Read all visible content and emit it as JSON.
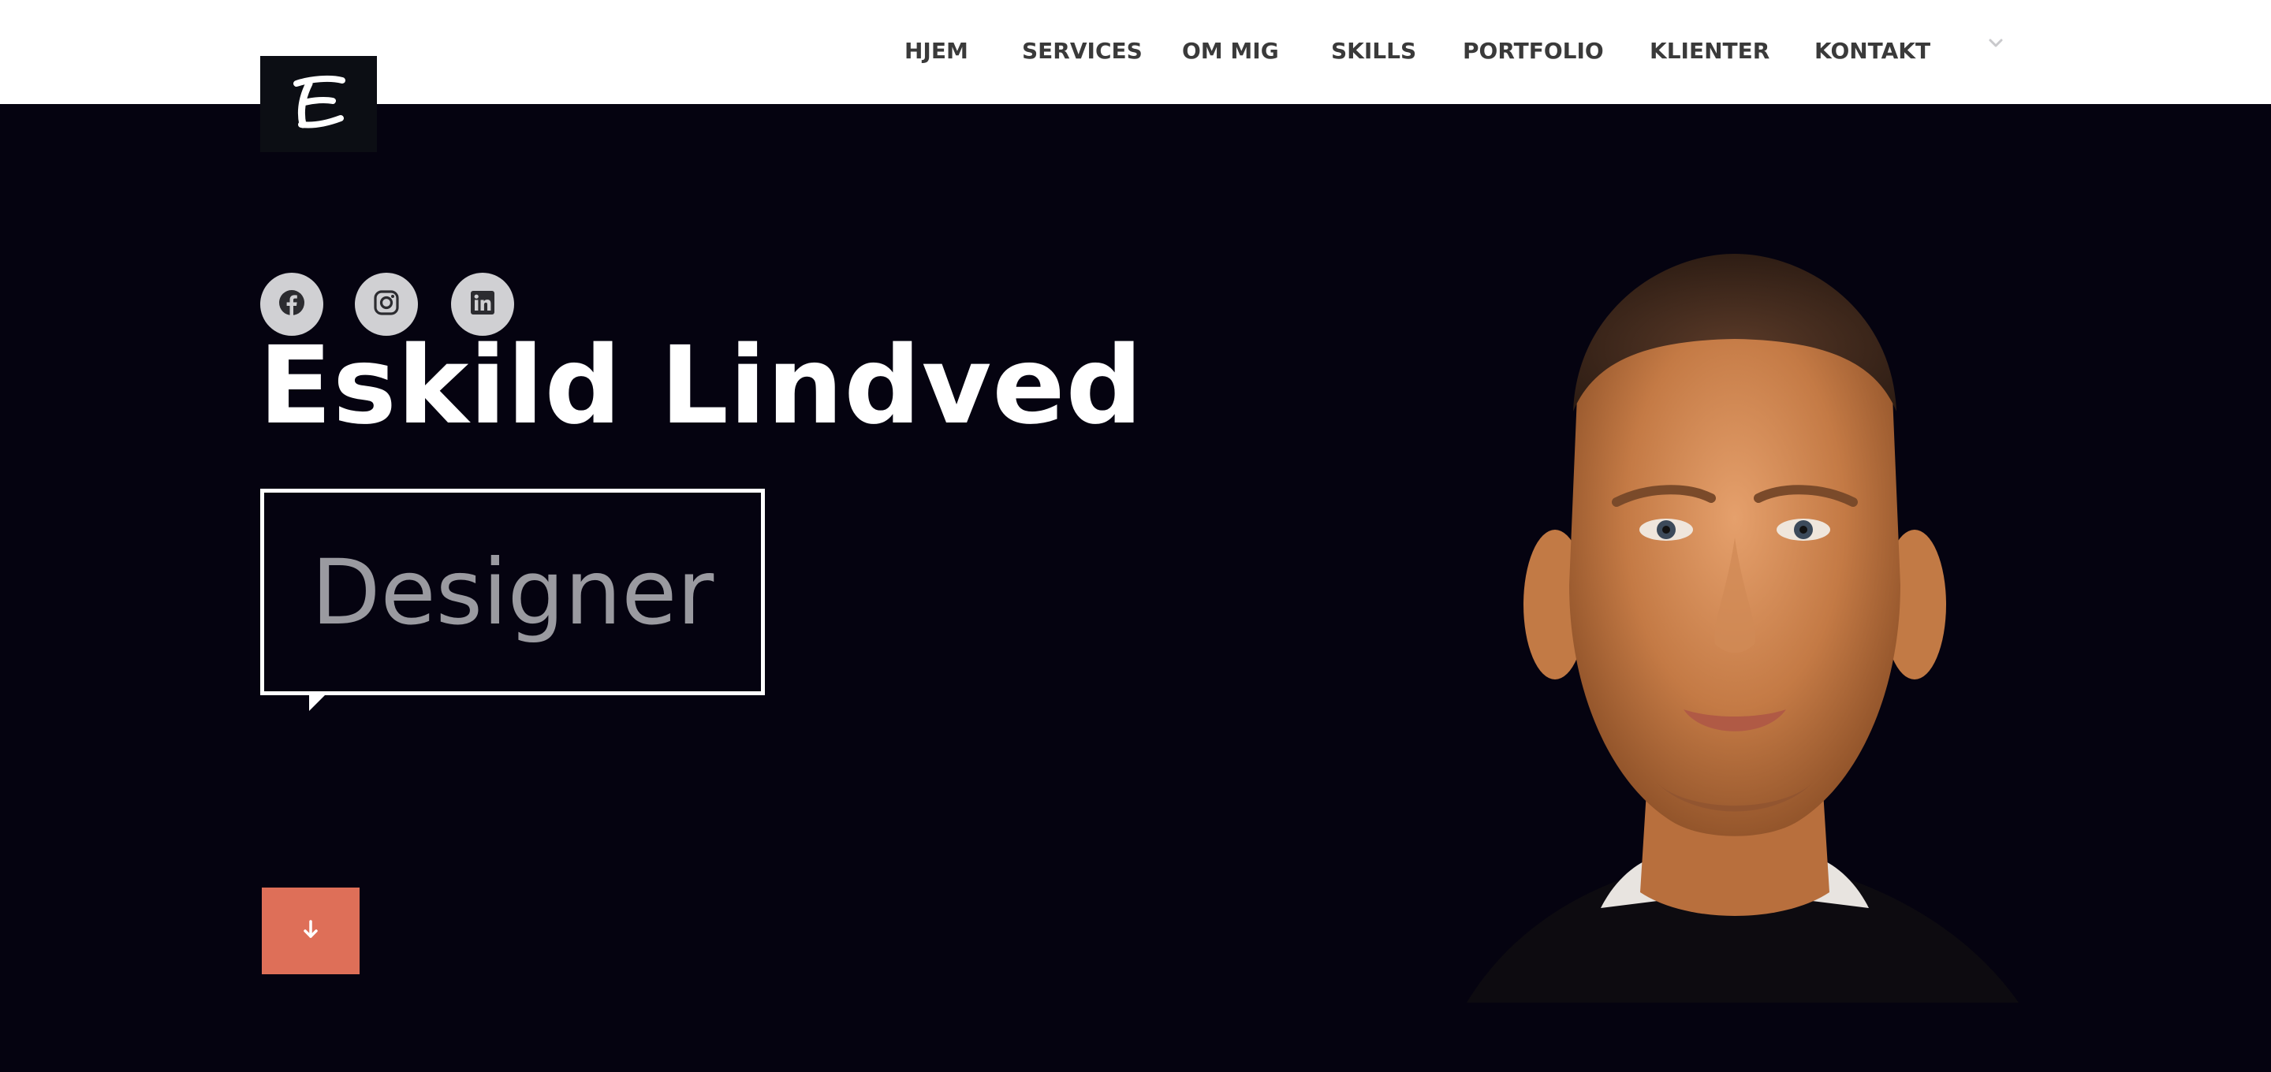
{
  "header": {
    "logo_icon": "e-letter-logo-icon",
    "nav": [
      {
        "label": "HJEM"
      },
      {
        "label": "SERVICES"
      },
      {
        "label": "OM MIG"
      },
      {
        "label": "SKILLS"
      },
      {
        "label": "PORTFOLIO"
      },
      {
        "label": "KLIENTER"
      },
      {
        "label": "KONTAKT"
      }
    ],
    "dropdown_icon": "chevron-down-icon"
  },
  "hero": {
    "social": [
      {
        "icon": "facebook-icon"
      },
      {
        "icon": "instagram-icon"
      },
      {
        "icon": "linkedin-icon"
      }
    ],
    "name": "Eskild Lindved",
    "role": "Designer",
    "scroll_icon": "arrow-down-icon",
    "portrait": "portrait-photo"
  },
  "colors": {
    "hero_background": "#050310",
    "accent": "#de6f58",
    "social_button": "#d0d0d3",
    "nav_text": "#3a3a3a",
    "role_text": "#9a9aa0"
  }
}
